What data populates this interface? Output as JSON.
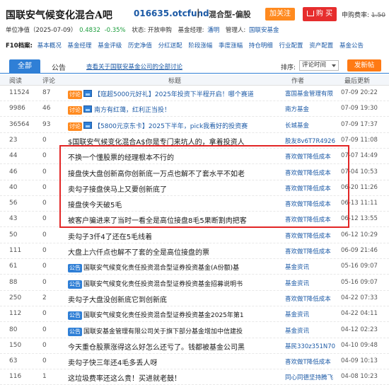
{
  "fund": {
    "name": "国联安气候变化混合A吧",
    "code": "016635.otcfund",
    "separator": "|",
    "type": "混合型-偏股",
    "follow_label": "加关注",
    "buy_label": "购 买",
    "fee_label": "申购费率:",
    "fee_value": "1.50"
  },
  "info": {
    "nav_label": "单位净值（2025-07-09）",
    "nav_value": "0.4832",
    "change": "-0.35%",
    "status": "状态: 开放申购",
    "manager_label": "基金经理:",
    "manager": "潘明",
    "company_label": "管理人:",
    "company": "国联安基金"
  },
  "archive": {
    "label": "F10档案:",
    "items": [
      "基本概况",
      "基金经理",
      "基金评级",
      "历史净值",
      "分红送配",
      "阶段涨幅",
      "季度涨幅",
      "持仓明细",
      "行业配置",
      "资产配置",
      "基金公告"
    ]
  },
  "tabs": {
    "all": "全部",
    "announcement": "公告",
    "company_link": "查看关于国联安基金公司的全部讨论",
    "sort_label": "排序:",
    "sort_value": "评论时间",
    "post_label": "发新帖"
  },
  "columns": {
    "read": "阅读",
    "comment": "评论",
    "title": "标题",
    "author": "作者",
    "time": "最后更新"
  },
  "rows": [
    {
      "read": "11524",
      "comment": "87",
      "tag": "讨论",
      "icon": true,
      "title": "【寇超5000元好礼】2025年投资下半程开启！哪个赛道",
      "author": "富国基金管理有限",
      "time": "07-09 20:22"
    },
    {
      "read": "9986",
      "comment": "46",
      "tag": "讨论",
      "icon": true,
      "title": "南方有红蔼，红利正当投！",
      "author": "南方基金",
      "time": "07-09 19:30"
    },
    {
      "read": "36564",
      "comment": "93",
      "tag": "讨论",
      "icon": true,
      "title": "【5800元京东卡】2025下半年，pick我看好的投资赛",
      "author": "长城基金",
      "time": "07-09 17:37"
    },
    {
      "read": "23",
      "comment": "0",
      "tag": "",
      "icon": false,
      "title": "$国联安气候变化混合A$你是专门来坑人的，拿着投资人",
      "author": "股友8v6T7R4926",
      "time": "07-09 11:08"
    },
    {
      "read": "44",
      "comment": "0",
      "tag": "",
      "icon": false,
      "title": "不换一个懂股票的经理根本不行的",
      "author": "喜欢做T降低成本",
      "time": "07-07 14:49"
    },
    {
      "read": "46",
      "comment": "0",
      "tag": "",
      "icon": false,
      "title": "接盘侠大盘创新高你创新底一万点也解不了套水平不如老",
      "author": "喜欢做T降低成本",
      "time": "07-04 10:53"
    },
    {
      "read": "40",
      "comment": "0",
      "tag": "",
      "icon": false,
      "title": "卖勾子接盘侠马上又要创新底了",
      "author": "喜欢做T降低成本",
      "time": "06-20 11:26"
    },
    {
      "read": "56",
      "comment": "0",
      "tag": "",
      "icon": false,
      "title": "接盘侠今天破5毛",
      "author": "喜欢做T降低成本",
      "time": "06-13 11:11"
    },
    {
      "read": "43",
      "comment": "0",
      "tag": "",
      "icon": false,
      "title": "被客户骗进来了当时一看全是高位接盘8毛5果断割肉把客",
      "author": "喜欢做T降低成本",
      "time": "06-12 13:55"
    },
    {
      "read": "50",
      "comment": "0",
      "tag": "",
      "icon": false,
      "title": "卖勾子3仟4了还在5毛线着",
      "author": "喜欢做T降低成本",
      "time": "06-12 10:29"
    },
    {
      "read": "111",
      "comment": "0",
      "tag": "",
      "icon": false,
      "title": "大盘上六仟点也解不了套的全是高位接盘的票",
      "author": "喜欢做T降低成本",
      "time": "06-09 21:46"
    },
    {
      "read": "61",
      "comment": "0",
      "tag": "公告",
      "icon": false,
      "title": "国联安气候变化责任投资混合型证券投资基金(A份额)基",
      "author": "基金资讯",
      "time": "05-16 09:07"
    },
    {
      "read": "88",
      "comment": "0",
      "tag": "公告",
      "icon": false,
      "title": "国联安气候变化责任投资混合型证券投资基金招募说明书",
      "author": "基金资讯",
      "time": "05-16 09:07"
    },
    {
      "read": "250",
      "comment": "2",
      "tag": "",
      "icon": false,
      "title": "卖勾子大盘没创新底它到创新底",
      "author": "喜欢做T降低成本",
      "time": "04-22 07:33"
    },
    {
      "read": "112",
      "comment": "0",
      "tag": "公告",
      "icon": false,
      "title": "国联安气候变化责任投资混合型证券投资基金2025年第1",
      "author": "基金资讯",
      "time": "04-22 04:11"
    },
    {
      "read": "80",
      "comment": "0",
      "tag": "公告",
      "icon": false,
      "title": "国联安基金管理有限公司关于旗下部分基金增加中信建投",
      "author": "基金资讯",
      "time": "04-12 02:23"
    },
    {
      "read": "150",
      "comment": "0",
      "tag": "",
      "icon": false,
      "title": "今天重仓股票涨得这么好怎么还亏了。钱都被基金公司黑",
      "author": "基民330z351N70",
      "time": "04-10 09:48"
    },
    {
      "read": "63",
      "comment": "0",
      "tag": "",
      "icon": false,
      "title": "卖勾子快三年还4毛多丢人呀",
      "author": "喜欢做T降低成本",
      "time": "04-09 10:13"
    },
    {
      "read": "116",
      "comment": "1",
      "tag": "",
      "icon": false,
      "title": "这垃圾费率还这么贵！买进就老鼓！",
      "author": "同心同德坚持腾飞",
      "time": "04-08 10:23"
    }
  ]
}
